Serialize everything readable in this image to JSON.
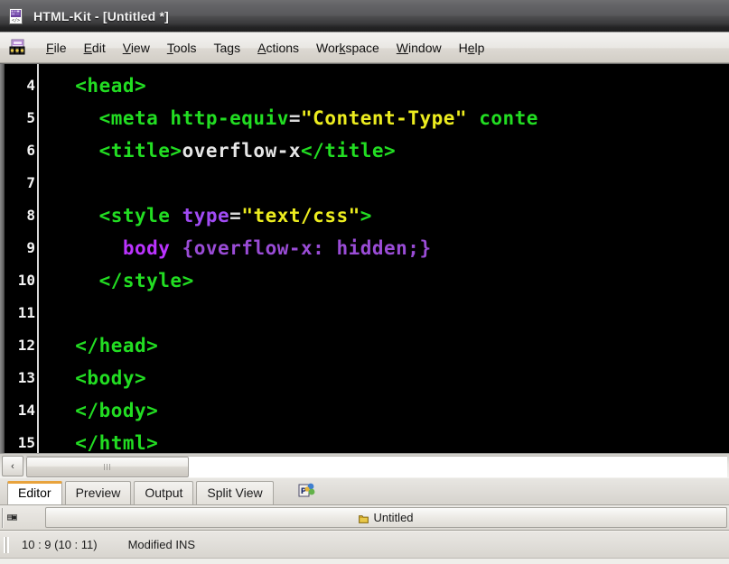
{
  "window": {
    "title": "HTML-Kit - [Untitled *]",
    "icon": "html-kit-app-icon"
  },
  "menubar": {
    "tool_icon": "html-kit-toolbar-icon",
    "items": [
      {
        "label": "File",
        "accel": "F"
      },
      {
        "label": "Edit",
        "accel": "E"
      },
      {
        "label": "View",
        "accel": "V"
      },
      {
        "label": "Tools",
        "accel": "T"
      },
      {
        "label": "Tags",
        "accel": "T"
      },
      {
        "label": "Actions",
        "accel": "A"
      },
      {
        "label": "Workspace",
        "accel": "k"
      },
      {
        "label": "Window",
        "accel": "W"
      },
      {
        "label": "Help",
        "accel": "H"
      }
    ]
  },
  "editor": {
    "first_visible_line": 4,
    "gutter_numbers": [
      "4",
      "5",
      "6",
      "7",
      "8",
      "9",
      "10",
      "11",
      "12",
      "13",
      "14"
    ],
    "lines": [
      {
        "number": "4",
        "tokens": [
          {
            "t": "  <head>",
            "c": "tag"
          }
        ]
      },
      {
        "number": "5",
        "tokens": [
          {
            "t": "    <meta http-equiv",
            "c": "tag"
          },
          {
            "t": "=",
            "c": "eq"
          },
          {
            "t": "\"Content-Type\"",
            "c": "val"
          },
          {
            "t": " conte",
            "c": "tag"
          }
        ]
      },
      {
        "number": "6",
        "tokens": [
          {
            "t": "    <title>",
            "c": "tag"
          },
          {
            "t": "overflow-x",
            "c": "text"
          },
          {
            "t": "</title>",
            "c": "tag"
          }
        ]
      },
      {
        "number": "7",
        "tokens": [
          {
            "t": "",
            "c": "text"
          }
        ]
      },
      {
        "number": "8",
        "tokens": [
          {
            "t": "    <style ",
            "c": "tag"
          },
          {
            "t": "type",
            "c": "attr2"
          },
          {
            "t": "=",
            "c": "eq"
          },
          {
            "t": "\"text/css\"",
            "c": "val"
          },
          {
            "t": ">",
            "c": "tag"
          }
        ]
      },
      {
        "number": "9",
        "tokens": [
          {
            "t": "      body ",
            "c": "sel"
          },
          {
            "t": "{overflow-x: hidden;}",
            "c": "css"
          }
        ]
      },
      {
        "number": "10",
        "tokens": [
          {
            "t": "    </style>",
            "c": "tag"
          }
        ]
      },
      {
        "number": "11",
        "tokens": [
          {
            "t": "",
            "c": "text"
          }
        ]
      },
      {
        "number": "12",
        "tokens": [
          {
            "t": "  </head>",
            "c": "tag"
          }
        ]
      },
      {
        "number": "13",
        "tokens": [
          {
            "t": "  <body>",
            "c": "tag"
          }
        ]
      },
      {
        "number": "14",
        "tokens": [
          {
            "t": "  </body>",
            "c": "tag"
          }
        ]
      },
      {
        "number": "15",
        "tokens": [
          {
            "t": "  </html>",
            "c": "tag"
          }
        ]
      }
    ],
    "colors": {
      "background": "#000000",
      "tag": "#22dd22",
      "text": "#e6e6e6",
      "attribute": "#a14bf4",
      "value": "#ecec1f",
      "selector": "#bb33ff",
      "css": "#9a4cd6",
      "gutter_text": "#f2f2f2"
    }
  },
  "hscrollbar": {
    "left_button_glyph": "‹",
    "thumb_grip": "scrollbar-grip"
  },
  "tabs": {
    "items": [
      {
        "label": "Editor",
        "active": true
      },
      {
        "label": "Preview",
        "active": false
      },
      {
        "label": "Output",
        "active": false
      },
      {
        "label": "Split View",
        "active": false
      }
    ],
    "active_indicator_color": "#e8a33d",
    "extra_icon": "plugins-icon"
  },
  "docbar": {
    "left_button_glyph": "▤▣",
    "document": {
      "label": "Untitled",
      "icon": "document-icon"
    }
  },
  "statusbar": {
    "position": "10 : 9 (10 : 11)",
    "mode": "Modified INS"
  }
}
